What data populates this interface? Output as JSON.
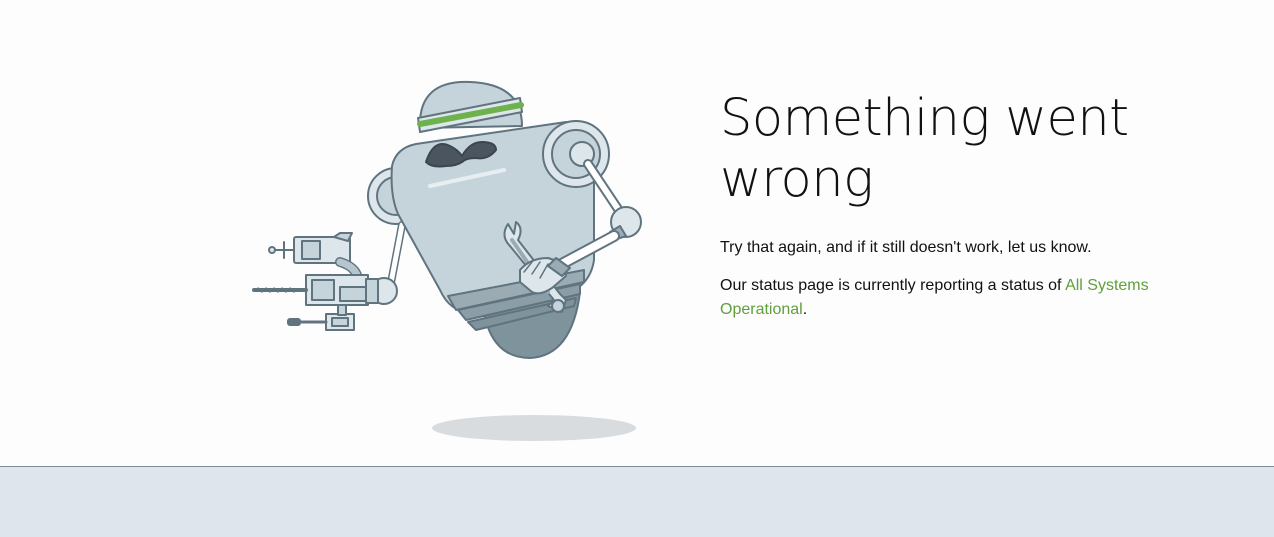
{
  "error": {
    "title": "Something went wrong",
    "retry_message": "Try that again, and if it still doesn't work, let us know.",
    "status_prefix": "Our status page is currently reporting a status of ",
    "status_link_text": "All Systems Operational",
    "status_suffix": "."
  },
  "illustration": {
    "name": "broken-robot-with-wrench"
  },
  "colors": {
    "link": "#5ea03a",
    "robot_body": "#c5d3da",
    "robot_outline": "#607480",
    "robot_dark": "#7f939c",
    "headband": "#6db24d",
    "footer_bg": "#dfe5ed"
  }
}
